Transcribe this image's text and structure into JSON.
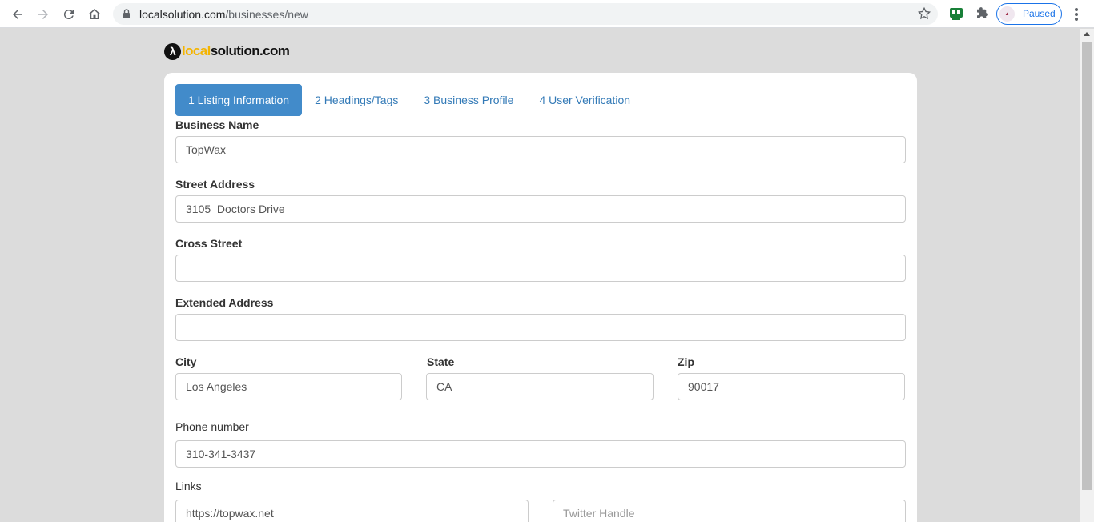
{
  "browser": {
    "url_host": "localsolution.com",
    "url_path": "/businesses/new",
    "profile_label": "Paused"
  },
  "logo": {
    "mark": "λ",
    "local": "local",
    "rest": "solution.com"
  },
  "tabs": [
    {
      "label": "1 Listing Information",
      "active": true
    },
    {
      "label": "2 Headings/Tags",
      "active": false
    },
    {
      "label": "3 Business Profile",
      "active": false
    },
    {
      "label": "4 User Verification",
      "active": false
    }
  ],
  "form": {
    "business_name": {
      "label": "Business Name",
      "value": "TopWax"
    },
    "street_address": {
      "label": "Street Address",
      "value": "3105  Doctors Drive"
    },
    "cross_street": {
      "label": "Cross Street",
      "value": ""
    },
    "extended_address": {
      "label": "Extended Address",
      "value": ""
    },
    "city": {
      "label": "City",
      "value": "Los Angeles"
    },
    "state": {
      "label": "State",
      "value": "CA"
    },
    "zip": {
      "label": "Zip",
      "value": "90017"
    },
    "phone": {
      "label": "Phone number",
      "value": "310-341-3437"
    },
    "links": {
      "label": "Links",
      "website_value": "https://topwax.net",
      "twitter_placeholder": "Twitter Handle"
    }
  }
}
